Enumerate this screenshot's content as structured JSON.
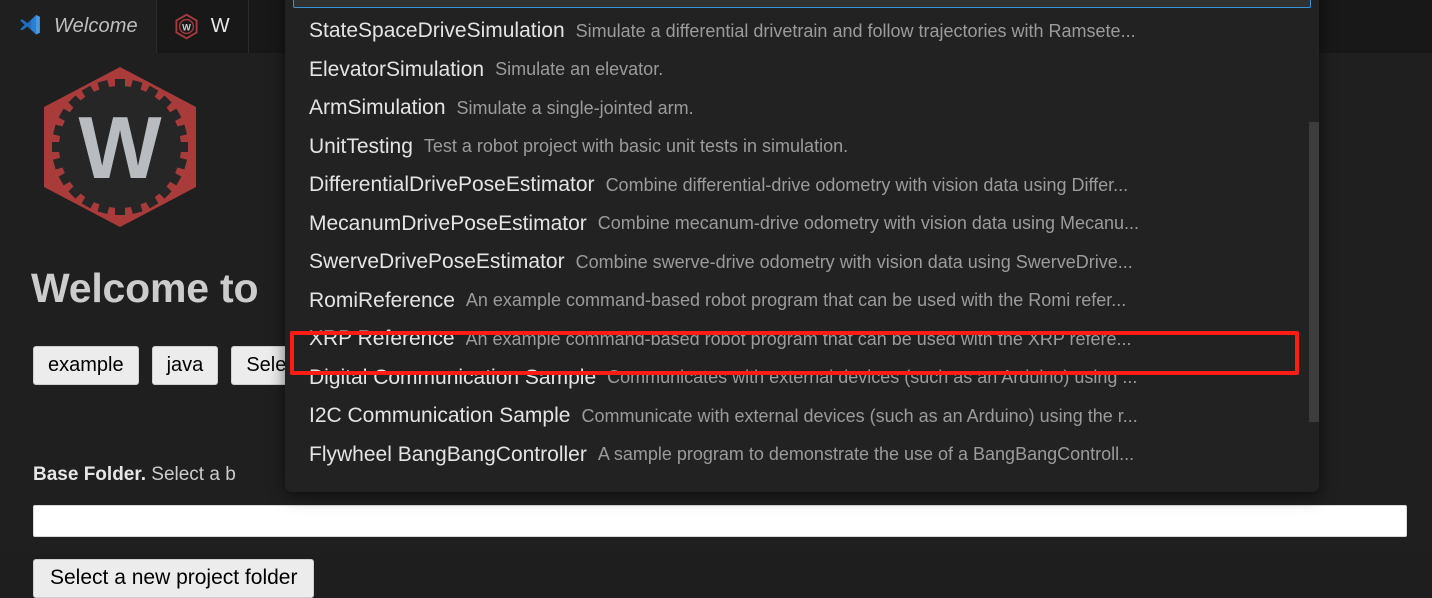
{
  "window": {
    "tabs": [
      {
        "label": "Welcome",
        "icon": "vscode-logo-icon",
        "active": true
      },
      {
        "label": "W",
        "icon": "wpilib-logo-icon",
        "active": false
      }
    ]
  },
  "welcome": {
    "logo_icon": "wpilib-hex-gear-logo",
    "logo_letter": "W",
    "heading": "Welcome to",
    "controls": [
      {
        "name": "project-type-button",
        "label": "example"
      },
      {
        "name": "language-button",
        "label": "java"
      },
      {
        "name": "select-project-button",
        "label": "Sele"
      }
    ],
    "base_folder": {
      "label_strong": "Base Folder.",
      "label_rest": " Select a b",
      "input_value": "",
      "input_placeholder": ""
    },
    "select_folder_button": "Select a new project folder"
  },
  "quickpick": {
    "search_value": "",
    "search_placeholder": "",
    "items": [
      {
        "label": "StateSpaceDriveSimulation",
        "description": "Simulate a differential drivetrain and follow trajectories with Ramsete...",
        "selected": false
      },
      {
        "label": "ElevatorSimulation",
        "description": "Simulate an elevator.",
        "selected": false
      },
      {
        "label": "ArmSimulation",
        "description": "Simulate a single-jointed arm.",
        "selected": false
      },
      {
        "label": "UnitTesting",
        "description": "Test a robot project with basic unit tests in simulation.",
        "selected": false
      },
      {
        "label": "DifferentialDrivePoseEstimator",
        "description": "Combine differential-drive odometry with vision data using Differ...",
        "selected": false
      },
      {
        "label": "MecanumDrivePoseEstimator",
        "description": "Combine mecanum-drive odometry with vision data using Mecanu...",
        "selected": false
      },
      {
        "label": "SwerveDrivePoseEstimator",
        "description": "Combine swerve-drive odometry with vision data using SwerveDrive...",
        "selected": false
      },
      {
        "label": "RomiReference",
        "description": "An example command-based robot program that can be used with the Romi refer...",
        "selected": false
      },
      {
        "label": "XRP Reference",
        "description": "An example command-based robot program that can be used with the XRP refere...",
        "selected": true
      },
      {
        "label": "Digital Communication Sample",
        "description": "Communicates with external devices (such as an Arduino) using ...",
        "selected": false
      },
      {
        "label": "I2C Communication Sample",
        "description": "Communicate with external devices (such as an Arduino) using the r...",
        "selected": false
      },
      {
        "label": "Flywheel BangBangController",
        "description": "A sample program to demonstrate the use of a BangBangControll...",
        "selected": false
      }
    ]
  },
  "annotation": {
    "target_label": "XRP Reference",
    "color": "#fd1d15"
  },
  "colors": {
    "editor_background": "#1f1f1f",
    "tabbar_background": "#181818",
    "quickpick_background": "#222222",
    "quickpick_focus_border": "#3794d8",
    "text_primary": "#e4e4e4",
    "text_secondary": "#9b9b9b",
    "wpilib_red": "#a93b3b",
    "annotation_red": "#fd1d15"
  }
}
